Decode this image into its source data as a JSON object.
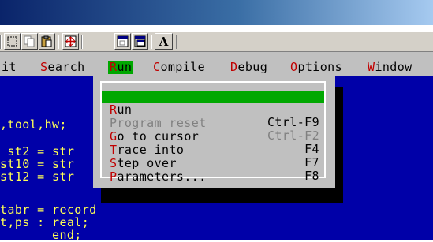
{
  "menubar": {
    "items": [
      {
        "pre": "",
        "hk": "",
        "rest": "it"
      },
      {
        "pre": "",
        "hk": "S",
        "rest": "earch"
      },
      {
        "pre": "",
        "hk": "R",
        "rest": "un"
      },
      {
        "pre": "",
        "hk": "C",
        "rest": "ompile"
      },
      {
        "pre": "",
        "hk": "D",
        "rest": "ebug"
      },
      {
        "pre": "",
        "hk": "O",
        "rest": "ptions"
      },
      {
        "pre": "",
        "hk": "W",
        "rest": "indow"
      }
    ]
  },
  "toolbar": {
    "font_button_label": "A"
  },
  "run_menu": {
    "items": [
      {
        "hk": "R",
        "rest": "un",
        "shortcut": "Ctrl-F9",
        "state": "selected"
      },
      {
        "hk": "",
        "rest": "Program reset",
        "shortcut": "Ctrl-F2",
        "state": "disabled"
      },
      {
        "hk": "G",
        "rest": "o to cursor",
        "shortcut": "F4",
        "state": "normal"
      },
      {
        "hk": "T",
        "rest": "race into",
        "shortcut": "F7",
        "state": "normal"
      },
      {
        "hk": "S",
        "rest": "tep over",
        "shortcut": "F8",
        "state": "normal"
      },
      {
        "hk": "P",
        "rest": "arameters...",
        "shortcut": "",
        "state": "normal"
      }
    ]
  },
  "editor": {
    "lines": [
      ",tool,hw;",
      " st2 = str",
      "st10 = str",
      "st12 = str",
      "tabr = record",
      "t,ps : real;",
      "       end;"
    ]
  },
  "colors": {
    "editor_bg": "#0000a8",
    "editor_text": "#ffff54",
    "menu_bg": "#c0c0c0",
    "highlight": "#00a800",
    "hotkey": "#c00000"
  }
}
